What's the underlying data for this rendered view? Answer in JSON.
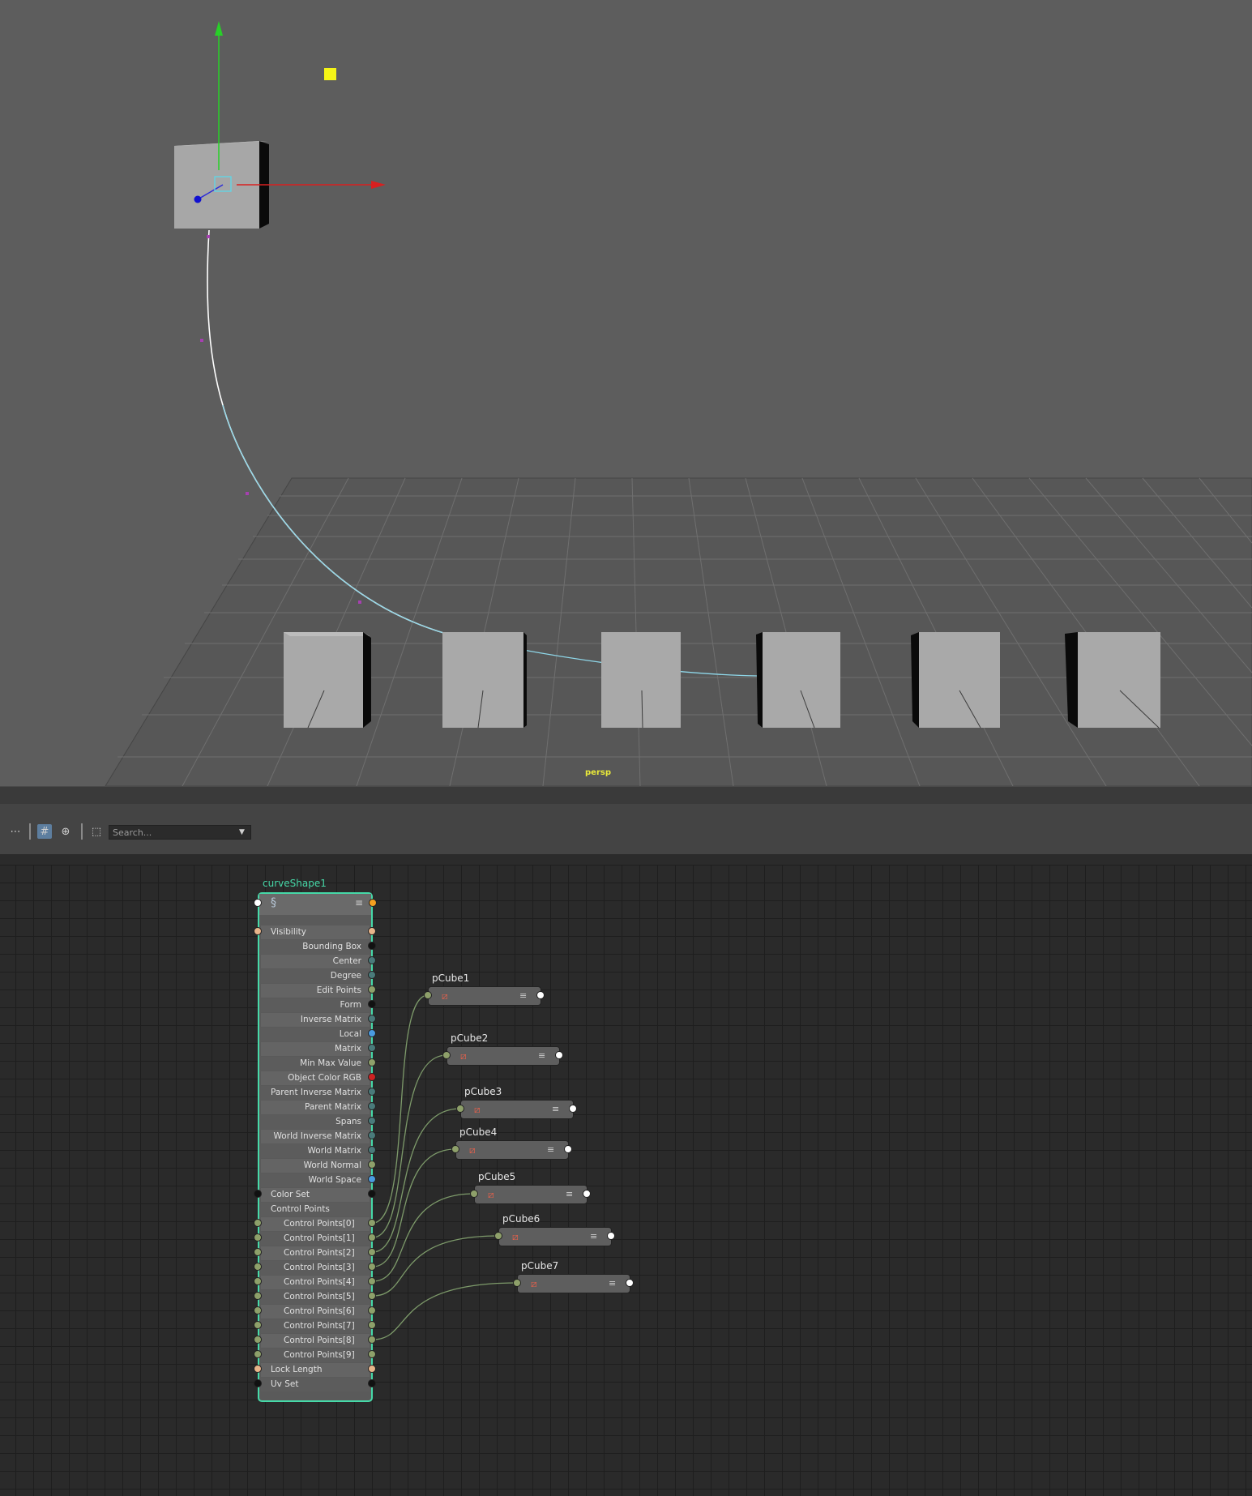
{
  "viewport": {
    "camera_label": "persp"
  },
  "toolbar": {
    "search_placeholder": "Search...",
    "icons": [
      "graph-layout-icon",
      "grid-icon",
      "filter-icon",
      "frame-icon"
    ]
  },
  "node_editor": {
    "curve_node": {
      "title": "curveShape1",
      "attributes": [
        {
          "label": "Visibility",
          "align": "left",
          "in": "#e8b48a",
          "out": "#e8b48a"
        },
        {
          "label": "Bounding Box",
          "align": "right",
          "out": "#111111"
        },
        {
          "label": "Center",
          "align": "right",
          "out": "#4a7a7a"
        },
        {
          "label": "Degree",
          "align": "right",
          "out": "#4a7a7a"
        },
        {
          "label": "Edit Points",
          "align": "right",
          "out": "#8ea06a"
        },
        {
          "label": "Form",
          "align": "right",
          "out": "#111111"
        },
        {
          "label": "Inverse Matrix",
          "align": "right",
          "out": "#4a7a7a"
        },
        {
          "label": "Local",
          "align": "right",
          "out": "#4a9be0"
        },
        {
          "label": "Matrix",
          "align": "right",
          "out": "#4a7a7a"
        },
        {
          "label": "Min Max Value",
          "align": "right",
          "out": "#8ea06a"
        },
        {
          "label": "Object Color RGB",
          "align": "right",
          "out": "#cc2222"
        },
        {
          "label": "Parent Inverse Matrix",
          "align": "right",
          "out": "#4a7a7a"
        },
        {
          "label": "Parent Matrix",
          "align": "right",
          "out": "#4a7a7a"
        },
        {
          "label": "Spans",
          "align": "right",
          "out": "#4a7a7a"
        },
        {
          "label": "World Inverse Matrix",
          "align": "right",
          "out": "#4a7a7a"
        },
        {
          "label": "World Matrix",
          "align": "right",
          "out": "#4a7a7a"
        },
        {
          "label": "World Normal",
          "align": "right",
          "out": "#8ea06a"
        },
        {
          "label": "World Space",
          "align": "right",
          "out": "#4a9be0"
        },
        {
          "label": "Color Set",
          "align": "left",
          "in": "#111111",
          "out": "#111111"
        },
        {
          "label": "Control Points",
          "align": "left"
        },
        {
          "label": "Control Points[0]",
          "align": "left",
          "indent": true,
          "in": "#8ea06a",
          "out": "#8ea06a"
        },
        {
          "label": "Control Points[1]",
          "align": "left",
          "indent": true,
          "in": "#8ea06a",
          "out": "#8ea06a"
        },
        {
          "label": "Control Points[2]",
          "align": "left",
          "indent": true,
          "in": "#8ea06a",
          "out": "#8ea06a"
        },
        {
          "label": "Control Points[3]",
          "align": "left",
          "indent": true,
          "in": "#8ea06a",
          "out": "#8ea06a"
        },
        {
          "label": "Control Points[4]",
          "align": "left",
          "indent": true,
          "in": "#8ea06a",
          "out": "#8ea06a"
        },
        {
          "label": "Control Points[5]",
          "align": "left",
          "indent": true,
          "in": "#8ea06a",
          "out": "#8ea06a"
        },
        {
          "label": "Control Points[6]",
          "align": "left",
          "indent": true,
          "in": "#8ea06a",
          "out": "#8ea06a"
        },
        {
          "label": "Control Points[7]",
          "align": "left",
          "indent": true,
          "in": "#8ea06a",
          "out": "#8ea06a"
        },
        {
          "label": "Control Points[8]",
          "align": "left",
          "indent": true,
          "in": "#8ea06a",
          "out": "#8ea06a"
        },
        {
          "label": "Control Points[9]",
          "align": "left",
          "indent": true,
          "in": "#8ea06a",
          "out": "#8ea06a"
        },
        {
          "label": "Lock Length",
          "align": "left",
          "in": "#e8b48a",
          "out": "#e8b48a"
        },
        {
          "label": "Uv Set",
          "align": "left",
          "in": "#111111",
          "out": "#111111"
        }
      ]
    },
    "cube_nodes": [
      {
        "label": "pCube1",
        "source_attr": 20
      },
      {
        "label": "pCube2",
        "source_attr": 21
      },
      {
        "label": "pCube3",
        "source_attr": 22
      },
      {
        "label": "pCube4",
        "source_attr": 23
      },
      {
        "label": "pCube5",
        "source_attr": 24
      },
      {
        "label": "pCube6",
        "source_attr": 25
      },
      {
        "label": "pCube7",
        "source_attr": 28
      }
    ]
  },
  "colors": {
    "selection": "#46d9a8",
    "connection": "#7d9a6a",
    "accent": "#5d7e9f"
  }
}
